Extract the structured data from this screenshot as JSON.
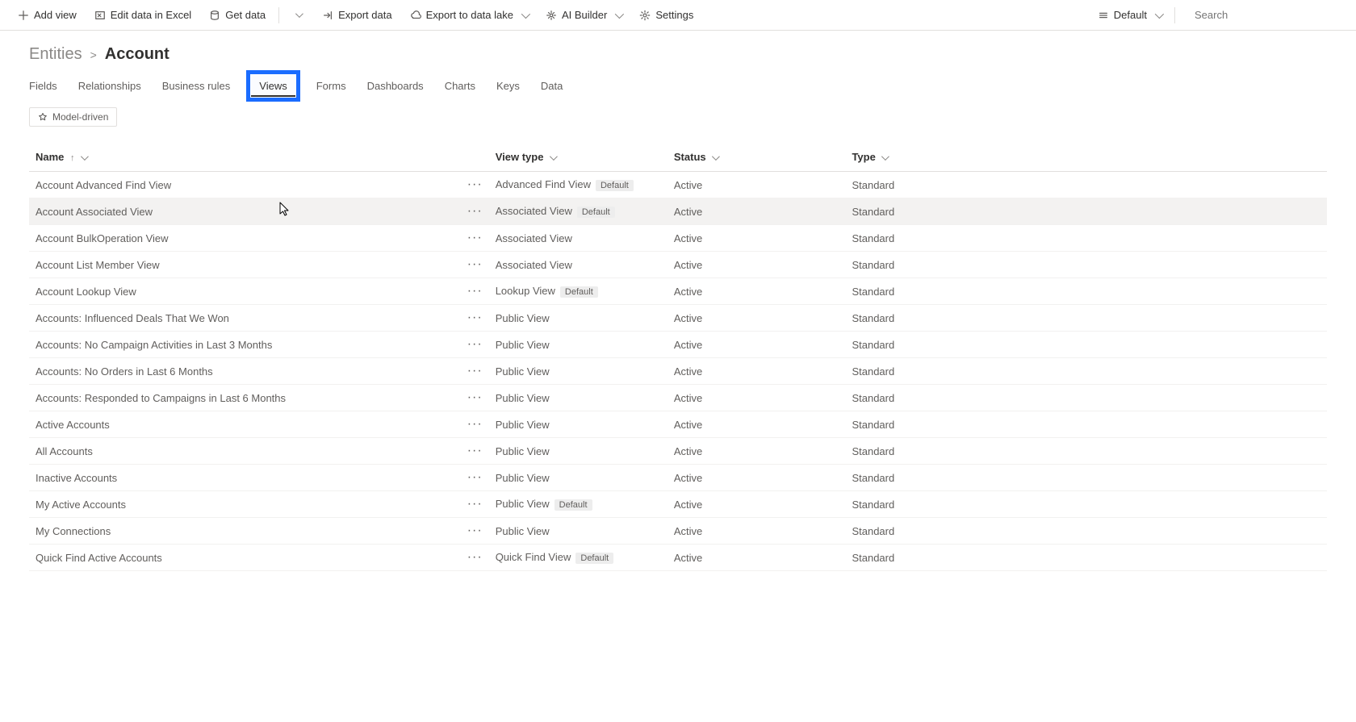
{
  "commandbar": {
    "add_view": "Add view",
    "edit_excel": "Edit data in Excel",
    "get_data": "Get data",
    "export_data": "Export data",
    "export_lake": "Export to data lake",
    "ai_builder": "AI Builder",
    "settings": "Settings",
    "default_dd": "Default",
    "search_placeholder": "Search"
  },
  "breadcrumb": {
    "root": "Entities",
    "leaf": "Account"
  },
  "tabs": {
    "fields": "Fields",
    "relationships": "Relationships",
    "business_rules": "Business rules",
    "views": "Views",
    "forms": "Forms",
    "dashboards": "Dashboards",
    "charts": "Charts",
    "keys": "Keys",
    "data": "Data"
  },
  "filter_chip": "Model-driven",
  "columns": {
    "name": "Name",
    "view_type": "View type",
    "status": "Status",
    "type": "Type"
  },
  "default_label": "Default",
  "rows": [
    {
      "name": "Account Advanced Find View",
      "view_type": "Advanced Find View",
      "default": true,
      "status": "Active",
      "type": "Standard"
    },
    {
      "name": "Account Associated View",
      "view_type": "Associated View",
      "default": true,
      "status": "Active",
      "type": "Standard",
      "hovered": true
    },
    {
      "name": "Account BulkOperation View",
      "view_type": "Associated View",
      "default": false,
      "status": "Active",
      "type": "Standard"
    },
    {
      "name": "Account List Member View",
      "view_type": "Associated View",
      "default": false,
      "status": "Active",
      "type": "Standard"
    },
    {
      "name": "Account Lookup View",
      "view_type": "Lookup View",
      "default": true,
      "status": "Active",
      "type": "Standard"
    },
    {
      "name": "Accounts: Influenced Deals That We Won",
      "view_type": "Public View",
      "default": false,
      "status": "Active",
      "type": "Standard"
    },
    {
      "name": "Accounts: No Campaign Activities in Last 3 Months",
      "view_type": "Public View",
      "default": false,
      "status": "Active",
      "type": "Standard"
    },
    {
      "name": "Accounts: No Orders in Last 6 Months",
      "view_type": "Public View",
      "default": false,
      "status": "Active",
      "type": "Standard"
    },
    {
      "name": "Accounts: Responded to Campaigns in Last 6 Months",
      "view_type": "Public View",
      "default": false,
      "status": "Active",
      "type": "Standard"
    },
    {
      "name": "Active Accounts",
      "view_type": "Public View",
      "default": false,
      "status": "Active",
      "type": "Standard"
    },
    {
      "name": "All Accounts",
      "view_type": "Public View",
      "default": false,
      "status": "Active",
      "type": "Standard"
    },
    {
      "name": "Inactive Accounts",
      "view_type": "Public View",
      "default": false,
      "status": "Active",
      "type": "Standard"
    },
    {
      "name": "My Active Accounts",
      "view_type": "Public View",
      "default": true,
      "status": "Active",
      "type": "Standard"
    },
    {
      "name": "My Connections",
      "view_type": "Public View",
      "default": false,
      "status": "Active",
      "type": "Standard"
    },
    {
      "name": "Quick Find Active Accounts",
      "view_type": "Quick Find View",
      "default": true,
      "status": "Active",
      "type": "Standard"
    }
  ]
}
